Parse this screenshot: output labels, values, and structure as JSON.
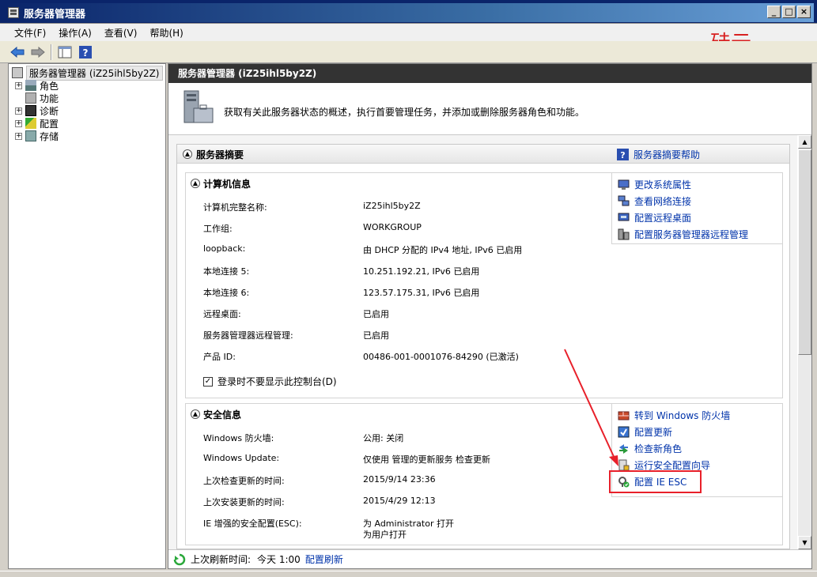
{
  "window": {
    "title": "服务器管理器",
    "min": "_",
    "max": "□",
    "close": "×"
  },
  "menu": [
    "文件(F)",
    "操作(A)",
    "查看(V)",
    "帮助(H)"
  ],
  "watermark": "硅云",
  "tree": {
    "root": "服务器管理器 (iZ25ihl5by2Z)",
    "items": [
      "角色",
      "功能",
      "诊断",
      "配置",
      "存储"
    ]
  },
  "main": {
    "header": "服务器管理器 (iZ25ihl5by2Z)",
    "intro": "获取有关此服务器状态的概述，执行首要管理任务，并添加或删除服务器角色和功能。",
    "summary": {
      "title": "服务器摘要",
      "help": "服务器摘要帮助"
    },
    "computer": {
      "title": "计算机信息",
      "rows": [
        {
          "label": "计算机完整名称:",
          "value": "iZ25ihl5by2Z"
        },
        {
          "label": "工作组:",
          "value": "WORKGROUP"
        },
        {
          "label": "loopback:",
          "value": "由 DHCP 分配的 IPv4 地址, IPv6 已启用"
        },
        {
          "label": "本地连接 5:",
          "value": "10.251.192.21, IPv6 已启用"
        },
        {
          "label": "本地连接 6:",
          "value": "123.57.175.31, IPv6 已启用"
        },
        {
          "label": "远程桌面:",
          "value": "已启用"
        },
        {
          "label": "服务器管理器远程管理:",
          "value": "已启用"
        },
        {
          "label": "产品 ID:",
          "value": "00486-001-0001076-84290 (已激活)"
        }
      ],
      "actions": [
        "更改系统属性",
        "查看网络连接",
        "配置远程桌面",
        "配置服务器管理器远程管理"
      ],
      "checkbox": "登录时不要显示此控制台(D)",
      "checkmark": "✓"
    },
    "security": {
      "title": "安全信息",
      "rows": [
        {
          "label": "Windows 防火墙:",
          "value": "公用: 关闭"
        },
        {
          "label": "Windows Update:",
          "value": "仅使用 管理的更新服务 检查更新"
        },
        {
          "label": "上次检查更新的时间:",
          "value": "2015/9/14 23:36"
        },
        {
          "label": "上次安装更新的时间:",
          "value": "2015/4/29 12:13"
        },
        {
          "label": "IE 增强的安全配置(ESC):",
          "value": "为 Administrator 打开",
          "value2": "为用户打开"
        }
      ],
      "actions": [
        "转到 Windows 防火墙",
        "配置更新",
        "检查新角色",
        "运行安全配置向导",
        "配置 IE ESC"
      ]
    },
    "status": {
      "label": "上次刷新时间:",
      "time": "今天 1:00",
      "refresh": "配置刷新"
    }
  }
}
